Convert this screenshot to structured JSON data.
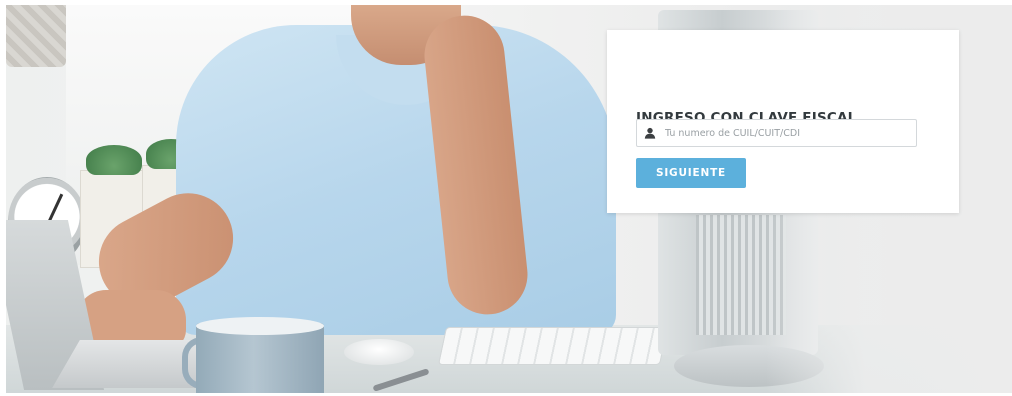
{
  "login": {
    "title": "INGRESO CON CLAVE FISCAL",
    "cuit_input": {
      "placeholder": "Tu numero de CUIL/CUIT/CDI",
      "value": "",
      "icon": "user-icon"
    },
    "next_button_label": "SIGUIENTE"
  },
  "colors": {
    "accent": "#5cb0dc",
    "title_text": "#333a3e",
    "card_background": "#ffffff"
  }
}
